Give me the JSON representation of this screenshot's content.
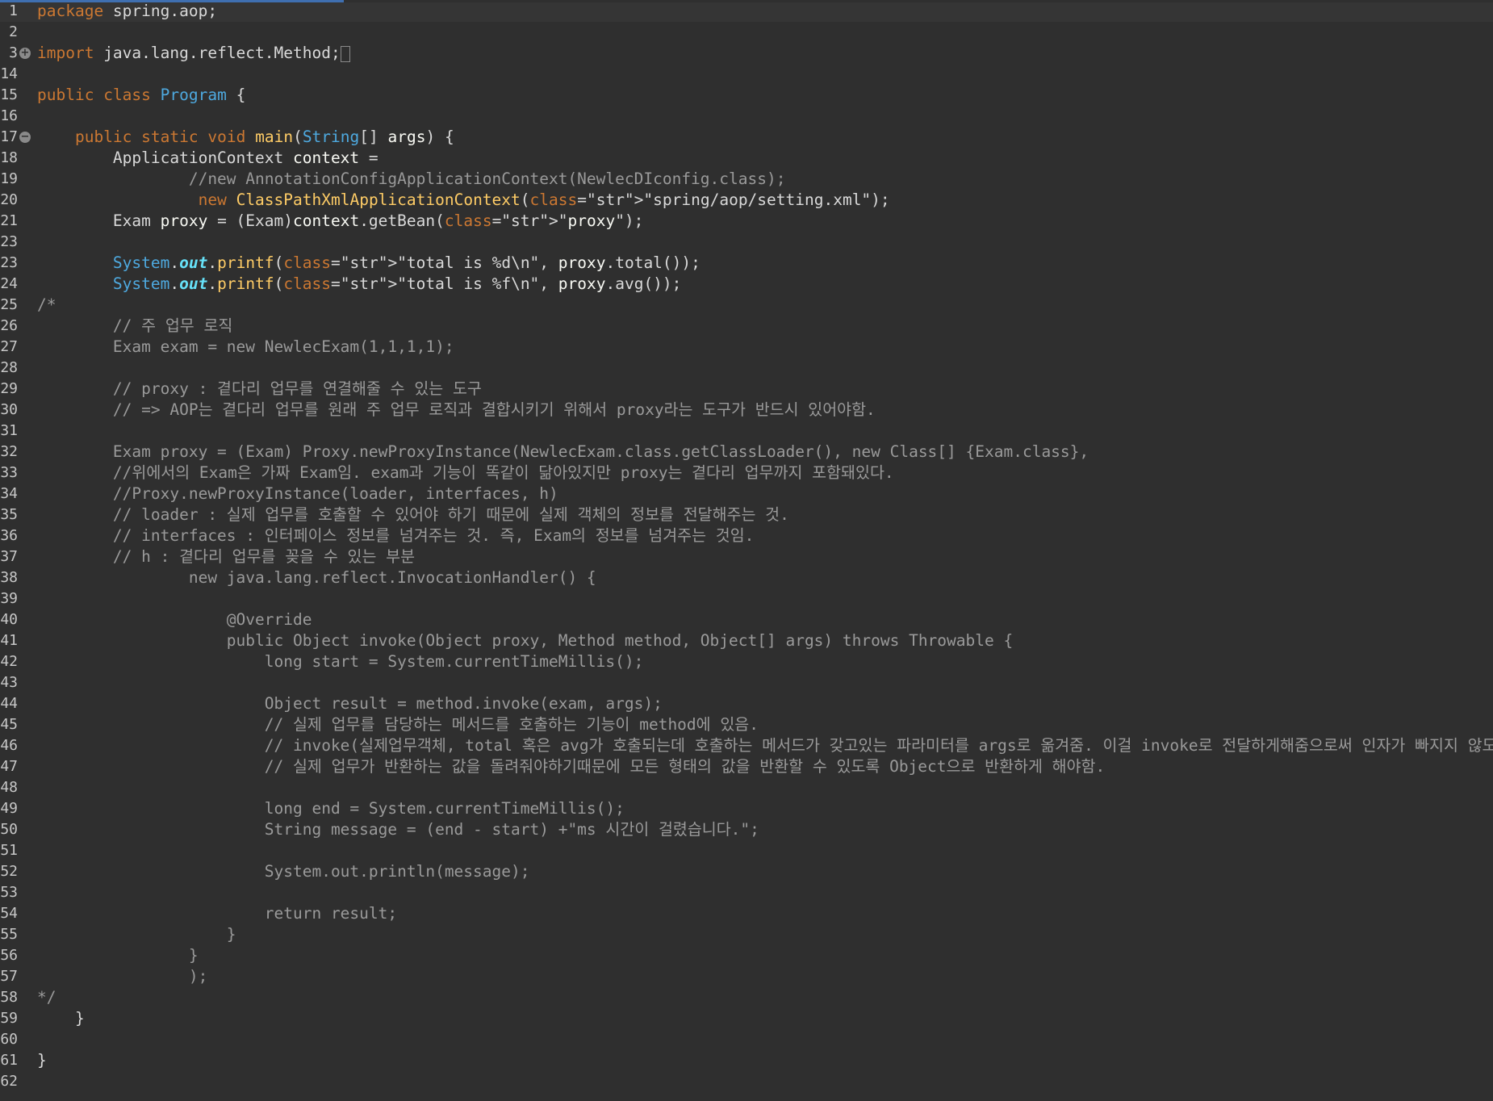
{
  "editor": {
    "lines": [
      {
        "n": "1",
        "code": "package spring.aop;"
      },
      {
        "n": "2",
        "code": ""
      },
      {
        "n": "3",
        "code": "import java.lang.reflect.Method;",
        "fold": "+"
      },
      {
        "n": "14",
        "code": ""
      },
      {
        "n": "15",
        "code": "public class Program {"
      },
      {
        "n": "16",
        "code": ""
      },
      {
        "n": "17",
        "code": "    public static void main(String[] args) {",
        "fold": "−"
      },
      {
        "n": "18",
        "code": "        ApplicationContext context ="
      },
      {
        "n": "19",
        "code": "                //new AnnotationConfigApplicationContext(NewlecDIconfig.class);"
      },
      {
        "n": "20",
        "code": "                 new ClassPathXmlApplicationContext(\"spring/aop/setting.xml\");"
      },
      {
        "n": "21",
        "code": "        Exam proxy = (Exam)context.getBean(\"proxy\");"
      },
      {
        "n": "23",
        "code": ""
      },
      {
        "n": "23",
        "code": "        System.out.printf(\"total is %d\\n\", proxy.total());"
      },
      {
        "n": "24",
        "code": "        System.out.printf(\"total is %f\\n\", proxy.avg());"
      },
      {
        "n": "25",
        "code": "/*"
      },
      {
        "n": "26",
        "code": "        // 주 업무 로직"
      },
      {
        "n": "27",
        "code": "        Exam exam = new NewlecExam(1,1,1,1);"
      },
      {
        "n": "28",
        "code": ""
      },
      {
        "n": "29",
        "code": "        // proxy : 곁다리 업무를 연결해줄 수 있는 도구"
      },
      {
        "n": "30",
        "code": "        // => AOP는 곁다리 업무를 원래 주 업무 로직과 결합시키기 위해서 proxy라는 도구가 반드시 있어야함."
      },
      {
        "n": "31",
        "code": ""
      },
      {
        "n": "32",
        "code": "        Exam proxy = (Exam) Proxy.newProxyInstance(NewlecExam.class.getClassLoader(), new Class[] {Exam.class},"
      },
      {
        "n": "33",
        "code": "        //위에서의 Exam은 가짜 Exam임. exam과 기능이 똑같이 닮아있지만 proxy는 곁다리 업무까지 포함돼있다."
      },
      {
        "n": "34",
        "code": "        //Proxy.newProxyInstance(loader, interfaces, h)"
      },
      {
        "n": "35",
        "code": "        // loader : 실제 업무를 호출할 수 있어야 하기 때문에 실제 객체의 정보를 전달해주는 것."
      },
      {
        "n": "36",
        "code": "        // interfaces : 인터페이스 정보를 넘겨주는 것. 즉, Exam의 정보를 넘겨주는 것임."
      },
      {
        "n": "37",
        "code": "        // h : 곁다리 업무를 꽂을 수 있는 부분"
      },
      {
        "n": "38",
        "code": "                new java.lang.reflect.InvocationHandler() {"
      },
      {
        "n": "39",
        "code": ""
      },
      {
        "n": "40",
        "code": "                    @Override"
      },
      {
        "n": "41",
        "code": "                    public Object invoke(Object proxy, Method method, Object[] args) throws Throwable {"
      },
      {
        "n": "42",
        "code": "                        long start = System.currentTimeMillis();"
      },
      {
        "n": "43",
        "code": ""
      },
      {
        "n": "44",
        "code": "                        Object result = method.invoke(exam, args);"
      },
      {
        "n": "45",
        "code": "                        // 실제 업무를 담당하는 메서드를 호출하는 기능이 method에 있음."
      },
      {
        "n": "46",
        "code": "                        // invoke(실제업무객체, total 혹은 avg가 호출되는데 호출하는 메서드가 갖고있는 파라미터를 args로 옮겨줌. 이걸 invoke로 전달하게해줌으로써 인자가 빠지지 않도록 한다.)"
      },
      {
        "n": "47",
        "code": "                        // 실제 업무가 반환하는 값을 돌려줘야하기때문에 모든 형태의 값을 반환할 수 있도록 Object으로 반환하게 해야함."
      },
      {
        "n": "48",
        "code": ""
      },
      {
        "n": "49",
        "code": "                        long end = System.currentTimeMillis();"
      },
      {
        "n": "50",
        "code": "                        String message = (end - start) +\"ms 시간이 걸렸습니다.\";"
      },
      {
        "n": "51",
        "code": ""
      },
      {
        "n": "52",
        "code": "                        System.out.println(message);"
      },
      {
        "n": "53",
        "code": ""
      },
      {
        "n": "54",
        "code": "                        return result;"
      },
      {
        "n": "55",
        "code": "                    }"
      },
      {
        "n": "56",
        "code": "                }"
      },
      {
        "n": "57",
        "code": "                );"
      },
      {
        "n": "58",
        "code": "*/"
      },
      {
        "n": "59",
        "code": "    }"
      },
      {
        "n": "60",
        "code": ""
      },
      {
        "n": "61",
        "code": "}"
      },
      {
        "n": "62",
        "code": ""
      }
    ]
  },
  "colors": {
    "background": "#2f2f2f",
    "keyword": "#cc7832",
    "class": "#4ea9df",
    "method": "#fecc66",
    "string": "#17c6a3",
    "comment": "#9a9a9a"
  }
}
